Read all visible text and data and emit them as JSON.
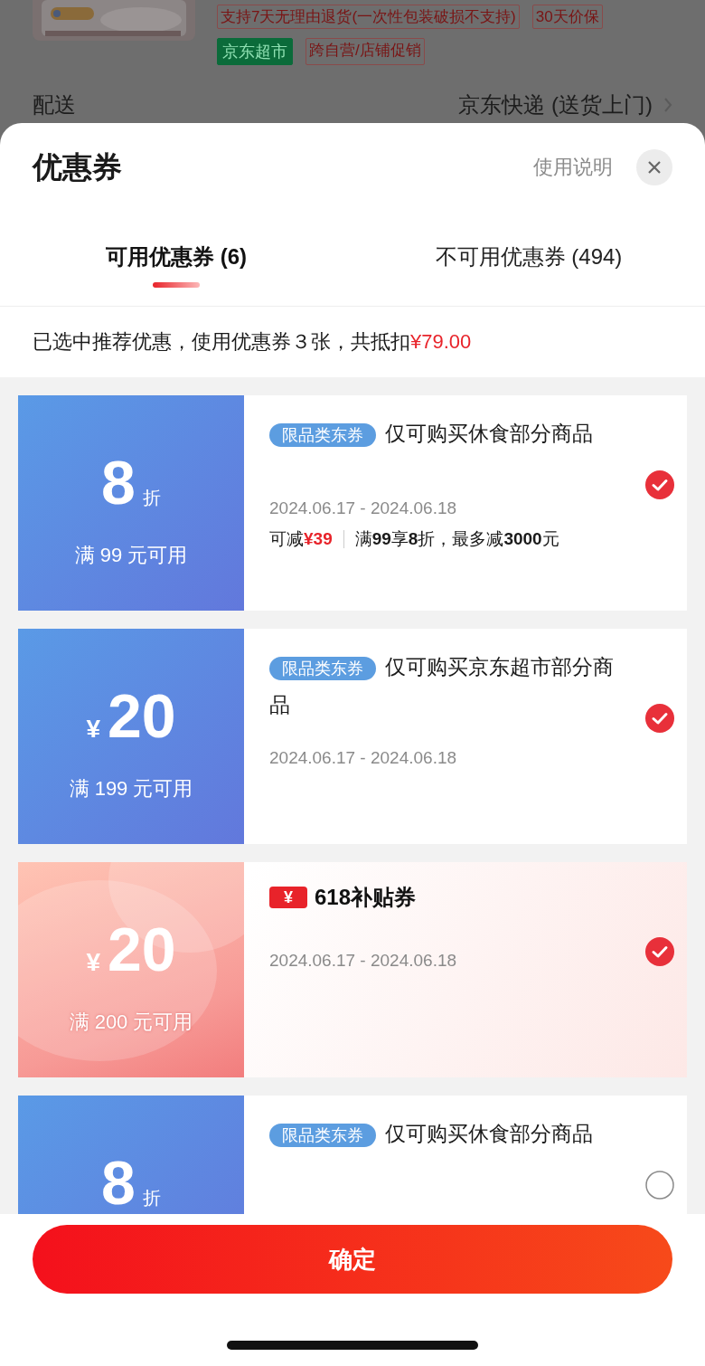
{
  "background_page": {
    "service_tags": [
      "支持7天无理由退货(一次性包装破损不支持)",
      "30天价保"
    ],
    "store_tags": [
      {
        "label": "京东超市",
        "kind": "filled"
      },
      {
        "label": "跨自营/店铺促销",
        "kind": "outline"
      }
    ],
    "delivery": {
      "label": "配送",
      "value": "京东快递 (送货上门)"
    }
  },
  "sheet": {
    "title": "优惠券",
    "help_link": "使用说明",
    "tabs": [
      {
        "label": "可用优惠券 (6)",
        "selected": true
      },
      {
        "label": "不可用优惠券 (494)",
        "selected": false
      }
    ],
    "summary": {
      "text": "已选中推荐优惠，使用优惠券３张，共抵扣",
      "amount": "¥79.00"
    },
    "coupons": [
      {
        "kind": "discount",
        "color": "#5a9ae6",
        "value": "8",
        "unit": "折",
        "condition": "满 99 元可用",
        "header": {
          "kind": "tag",
          "tag": "限品类东券",
          "text": "仅可购买休食部分商品"
        },
        "dates": "2024.06.17 - 2024.06.18",
        "saving_label": "可减",
        "saving": "¥39",
        "rule": "满**99**享**8**折，最多减**3000**元",
        "selected": true
      },
      {
        "kind": "amount",
        "color": "#5a9ae6",
        "currency": "¥",
        "value": "20",
        "condition": "满 199 元可用",
        "header": {
          "kind": "tag",
          "tag": "限品类东券",
          "text": "仅可购买京东超市部分商品"
        },
        "dates": "2024.06.17 - 2024.06.18",
        "selected": true
      },
      {
        "kind": "amount",
        "color": "#f79a96",
        "currency": "¥",
        "value": "20",
        "condition": "满 200 元可用",
        "header": {
          "kind": "subsidy",
          "badge": "¥",
          "text": "618补贴券"
        },
        "dates": "2024.06.17 - 2024.06.18",
        "selected": true
      },
      {
        "kind": "discount",
        "color": "#5a9ae6",
        "value": "8",
        "unit": "折",
        "header": {
          "kind": "tag",
          "tag": "限品类东券",
          "text": "仅可购买休食部分商品"
        },
        "selected": false
      }
    ],
    "confirm_button": "确定"
  }
}
